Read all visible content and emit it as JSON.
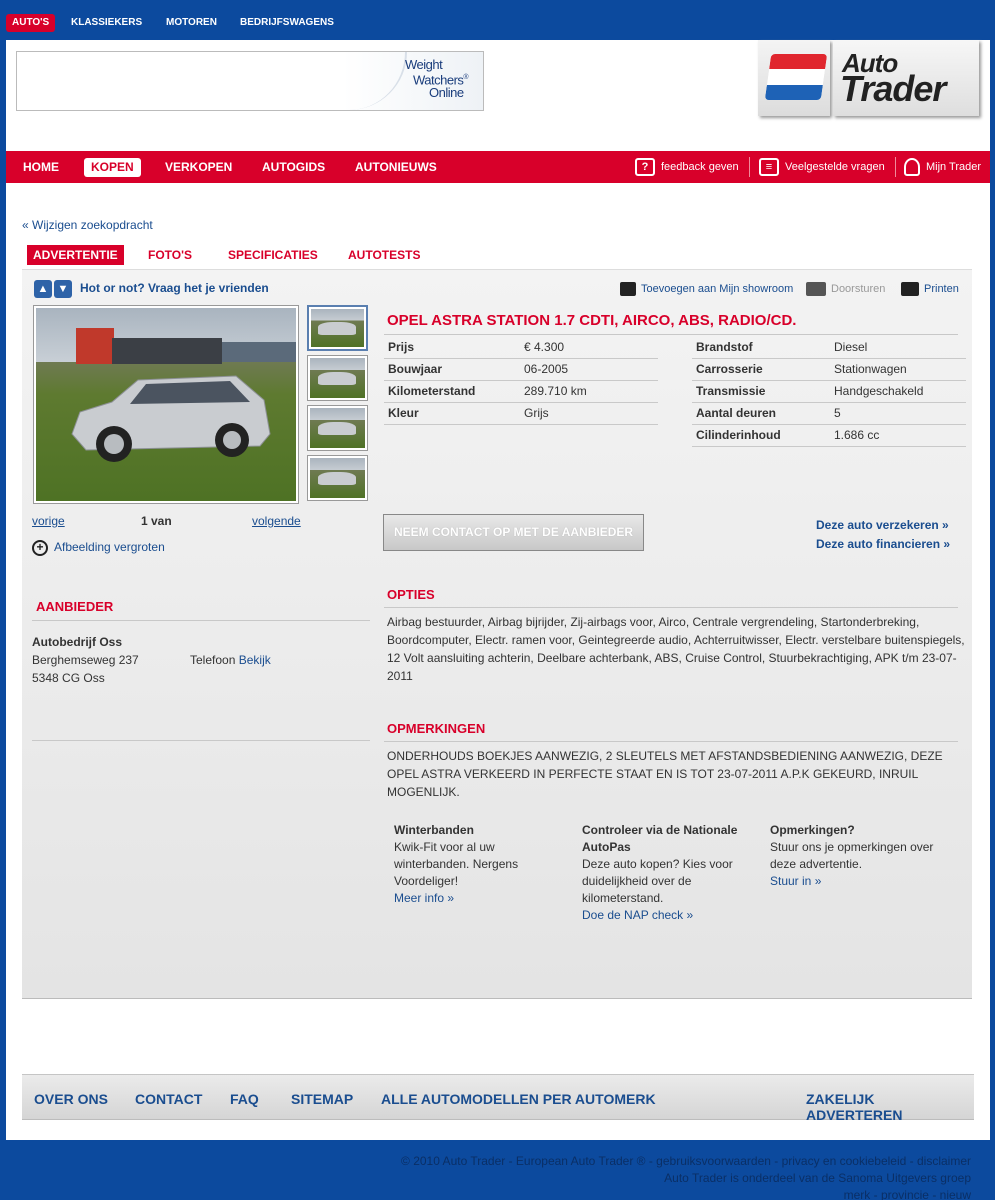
{
  "topnav": {
    "items": [
      "AUTO'S",
      "KLASSIEKERS",
      "MOTOREN",
      "BEDRIJFSWAGENS"
    ]
  },
  "banner": {
    "line1": "Weight",
    "line2": "Watchers",
    "line3": "Online",
    "mark": "®"
  },
  "logo": {
    "line1": "Auto",
    "line2": "Trader",
    "flag_colors": [
      "#e0262e",
      "#ffffff",
      "#1e62b6"
    ]
  },
  "mainnav": {
    "items": [
      "HOME",
      "KOPEN",
      "VERKOPEN",
      "AUTOGIDS",
      "AUTONIEUWS"
    ],
    "utility": [
      "feedback geven",
      "Veelgestelde vragen",
      "Mijn Trader"
    ]
  },
  "back_link": "« Wijzigen zoekopdracht",
  "tabs": [
    "ADVERTENTIE",
    "FOTO'S",
    "SPECIFICATIES",
    "AUTOTESTS"
  ],
  "hot_or_not": "Hot or not? Vraag het je vrienden",
  "actions": {
    "showroom": "Toevoegen aan Mijn showroom",
    "forward": "Doorsturen",
    "print": "Printen"
  },
  "gallery": {
    "prev": "vorige",
    "counter": "1 van",
    "next": "volgende",
    "enlarge": "Afbeelding vergroten"
  },
  "dealer": {
    "section_title": "AANBIEDER",
    "name": "Autobedrijf Oss",
    "street": "Berghemseweg 237",
    "city": "5348 CG Oss",
    "phone_label": "Telefoon",
    "phone_link": "Bekijk"
  },
  "car": {
    "title": "OPEL ASTRA STATION 1.7 CDTI, AIRCO, ABS, RADIO/CD.",
    "specs_left": [
      {
        "label": "Prijs",
        "value": "€ 4.300"
      },
      {
        "label": "Bouwjaar",
        "value": "06-2005"
      },
      {
        "label": "Kilometerstand",
        "value": "289.710 km"
      },
      {
        "label": "Kleur",
        "value": "Grijs"
      }
    ],
    "specs_right": [
      {
        "label": "Brandstof",
        "value": "Diesel"
      },
      {
        "label": "Carrosserie",
        "value": "Stationwagen"
      },
      {
        "label": "Transmissie",
        "value": "Handgeschakeld"
      },
      {
        "label": "Aantal deuren",
        "value": "5"
      },
      {
        "label": "Cilinderinhoud",
        "value": "1.686 cc"
      }
    ],
    "photo_color": "#c9ccd0"
  },
  "contact_button": "NEEM CONTACT OP MET DE AANBIEDER",
  "side_links": [
    "Deze auto verzekeren »",
    "Deze auto financieren »"
  ],
  "options": {
    "title": "OPTIES",
    "text": "Airbag bestuurder, Airbag bijrijder, Zij-airbags voor, Airco, Centrale vergrendeling, Startonderbreking, Boordcomputer, Electr. ramen voor, Geintegreerde audio, Achterruitwisser, Electr. verstelbare buitenspiegels, 12 Volt aansluiting achterin, Deelbare achterbank, ABS, Cruise Control, Stuurbekrachtiging, APK t/m 23-07-2011"
  },
  "remarks": {
    "title": "OPMERKINGEN",
    "text": "ONDERHOUDS BOEKJES AANWEZIG, 2 SLEUTELS MET AFSTANDSBEDIENING AANWEZIG, DEZE OPEL ASTRA VERKEERD IN PERFECTE STAAT EN IS TOT 23-07-2011 A.P.K GEKEURD, INRUIL MOGENLIJK."
  },
  "promos": [
    {
      "title": "Winterbanden",
      "text": "Kwik-Fit voor al uw winterbanden. Nergens Voordeliger!",
      "link": "Meer info »"
    },
    {
      "title": "Controleer via de Nationale AutoPas",
      "text": "Deze auto kopen? Kies voor duidelijkheid over de kilometerstand.",
      "link": "Doe de NAP check »"
    },
    {
      "title": "Opmerkingen?",
      "text": "Stuur ons je opmerkingen over deze advertentie.",
      "link": "Stuur in »"
    }
  ],
  "footer": {
    "links": [
      "OVER ONS",
      "CONTACT",
      "FAQ",
      "SITEMAP",
      "ALLE AUTOMODELLEN PER AUTOMERK"
    ],
    "right_link": "ZAKELIJK ADVERTEREN"
  },
  "copyright": {
    "line1": "© 2010 Auto Trader - European Auto Trader ® - gebruiksvoorwaarden - privacy en cookiebeleid - disclaimer",
    "line2": "Auto Trader is onderdeel van de Sanoma Uitgevers groep",
    "line3": "merk - provincie - nieuw"
  },
  "colors": {
    "brand_red": "#d8002a",
    "brand_blue": "#0c4a9e",
    "link_blue": "#1a4d8f"
  }
}
